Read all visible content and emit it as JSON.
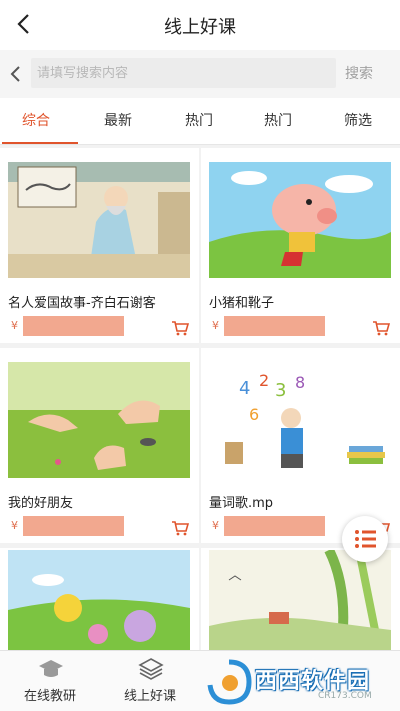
{
  "header": {
    "title": "线上好课"
  },
  "search": {
    "placeholder": "请填写搜索内容",
    "button_label": "搜索"
  },
  "tabs": [
    {
      "label": "综合",
      "active": true
    },
    {
      "label": "最新",
      "active": false
    },
    {
      "label": "热门",
      "active": false
    },
    {
      "label": "热门",
      "active": false
    },
    {
      "label": "筛选",
      "active": false
    }
  ],
  "courses": [
    {
      "title": "名人爱国故事-齐白石谢客",
      "currency": "¥"
    },
    {
      "title": "小猪和靴子",
      "currency": "¥"
    },
    {
      "title": "我的好朋友",
      "currency": "¥"
    },
    {
      "title": "量词歌.mp",
      "currency": "¥"
    },
    {
      "title": "",
      "currency": ""
    },
    {
      "title": "",
      "currency": ""
    }
  ],
  "bottom_nav": [
    {
      "label": "在线教研",
      "icon": "graduation-cap-icon"
    },
    {
      "label": "线上好课",
      "icon": "layers-icon"
    }
  ],
  "watermark": {
    "text": "西西软件园",
    "sub": "CR173.COM"
  },
  "colors": {
    "accent": "#e0542c",
    "price_mask": "#f2a88f",
    "background": "#f2f2f2"
  }
}
